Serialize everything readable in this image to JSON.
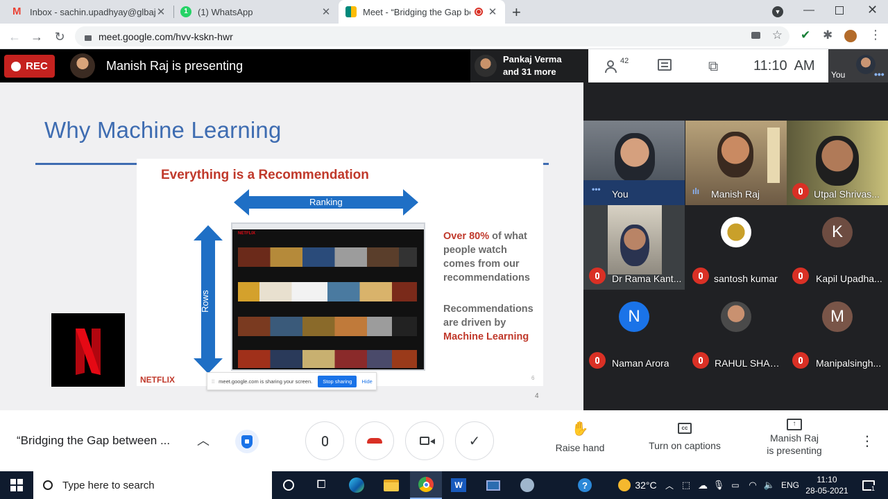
{
  "browser": {
    "tabs": [
      {
        "title": "Inbox - sachin.upadhyay@glbajaj",
        "icon": "gmail-icon",
        "color": "#ea4335"
      },
      {
        "title": "(1) WhatsApp",
        "icon": "whatsapp-icon",
        "color": "#25d366"
      },
      {
        "title": "Meet - “Bridging the Gap be",
        "icon": "meet-icon",
        "color": "#00897b"
      }
    ],
    "new_tab": "+",
    "url": "meet.google.com/hvv-kskn-hwr"
  },
  "meet": {
    "rec_label": "REC",
    "presenting_label": "Manish Raj is presenting",
    "others_line1": "Pankaj Verma",
    "others_line2": "and 31 more",
    "people_count": "42",
    "time": "11:10  AM",
    "self_label": "You",
    "slide": {
      "title": "Why Machine Learning",
      "headline": "Everything is a Recommendation",
      "ranking": "Ranking",
      "rows": "Rows",
      "p1_bold": "Over 80%",
      "p1_rest": " of what people watch comes from our recommendations",
      "p2_a": "Recommendations are driven by ",
      "p2_b": "Machine Learning",
      "brand": "NETFLIX",
      "inner_num": "6",
      "slide_num": "4",
      "share_text": "meet.google.com is sharing your screen.",
      "stop_sharing": "Stop sharing",
      "hide": "Hide"
    },
    "participants": [
      {
        "name": "You",
        "muted": false,
        "type": "video"
      },
      {
        "name": "Manish Raj",
        "muted": false,
        "type": "video"
      },
      {
        "name": "Utpal Shrivas...",
        "muted": true,
        "type": "video"
      },
      {
        "name": "Dr Rama Kant...",
        "muted": true,
        "type": "video"
      },
      {
        "name": "santosh kumar",
        "muted": true,
        "type": "logo"
      },
      {
        "name": "Kapil Upadha...",
        "muted": true,
        "type": "letter",
        "letter": "K",
        "color": "#6d4c41"
      },
      {
        "name": "Naman Arora",
        "muted": true,
        "type": "letter",
        "letter": "N",
        "color": "#1a73e8"
      },
      {
        "name": "RAHUL SHAR...",
        "muted": true,
        "type": "photo"
      },
      {
        "name": "Manipalsingh...",
        "muted": true,
        "type": "letter",
        "letter": "M",
        "color": "#795548"
      }
    ],
    "meeting_title": "“Bridging the Gap between ...",
    "raise_hand": "Raise hand",
    "captions": "Turn on captions",
    "presenter_line1": "Manish Raj",
    "presenter_line2": "is presenting"
  },
  "taskbar": {
    "search_placeholder": "Type here to search",
    "weather": "32°C",
    "lang": "ENG",
    "clock_time": "11:10",
    "clock_date": "28-05-2021",
    "notif_count": "1"
  }
}
